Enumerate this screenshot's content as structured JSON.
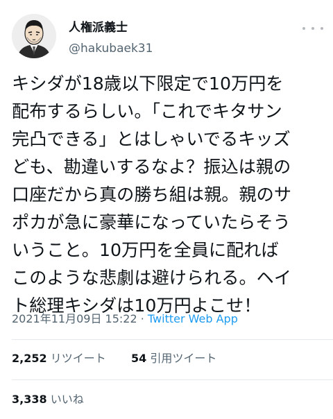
{
  "author": {
    "display_name": "人権派義士",
    "handle": "@hakubaek31"
  },
  "tweet": {
    "lines": [
      "キシダが18歳以下限定で10万円を",
      "配布するらしい。「これでキタサン",
      "完凸できる」とはしゃいでるキッズ",
      "ども、勘違いするなよ？振込は親の",
      "口座だから真の勝ち組は親。親のサ",
      "ポカが急に豪華になっていたらそう",
      "いうこと。10万円を全員に配れば",
      "このような悲劇は避けられる。ヘイ",
      "ト総理キシダは10万円よこせ！"
    ]
  },
  "meta": {
    "timestamp": "2021年11月09日 15:22",
    "separator": "·",
    "source_app": "Twitter Web App"
  },
  "stats": {
    "retweets_count": "2,252",
    "retweets_label": "リツイート",
    "quotes_count": "54",
    "quotes_label": "引用ツイート",
    "likes_count": "3,338",
    "likes_label": "いいね"
  },
  "icons": {
    "more": "more-options-icon",
    "avatar": "avatar"
  }
}
